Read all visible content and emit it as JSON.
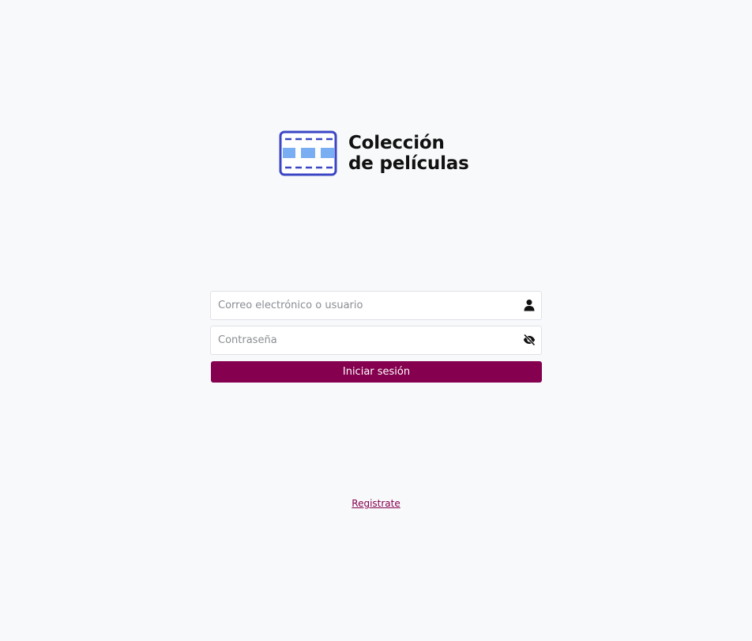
{
  "brand": {
    "title_line1": "Colección",
    "title_line2": "de películas",
    "logo_icon": "film-strip-icon",
    "logo_color": "#3b46c4",
    "logo_fill": "#7aaef2"
  },
  "login_form": {
    "user_placeholder": "Correo electrónico o usuario",
    "user_icon": "user-icon",
    "password_placeholder": "Contraseña",
    "password_icon": "eye-off-icon",
    "submit_label": "Iniciar sesión",
    "submit_color": "#85004f"
  },
  "footer": {
    "register_link": "Registrate"
  }
}
